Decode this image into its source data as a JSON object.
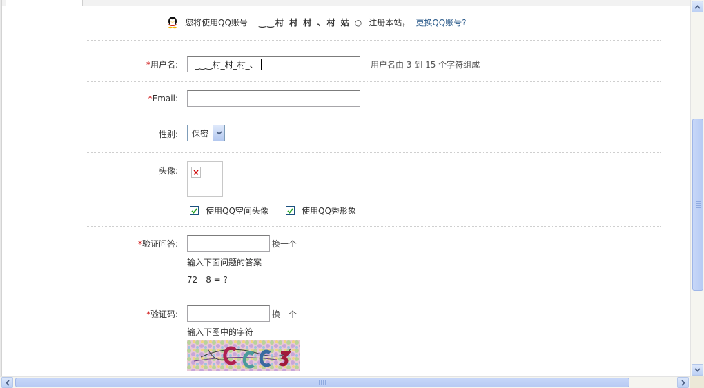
{
  "qq_notice": {
    "prefix": "您将使用QQ账号 -",
    "name": "‿‿村 村 村 、村 姑 ○",
    "suffix": "注册本站，",
    "change_link": "更换QQ账号?"
  },
  "form": {
    "username": {
      "label": "用户名:",
      "required_mark": "*",
      "value": "-_‿‿村_村_村_、",
      "hint": "用户名由 3 到 15 个字符组成"
    },
    "email": {
      "label": "Email:",
      "required_mark": "*",
      "value": ""
    },
    "gender": {
      "label": "性别:",
      "selected": "保密"
    },
    "avatar": {
      "label": "头像:",
      "options": [
        {
          "label": "使用QQ空间头像",
          "checked": true
        },
        {
          "label": "使用QQ秀形象",
          "checked": true
        }
      ]
    },
    "qa": {
      "label": "验证问答:",
      "required_mark": "*",
      "value": "",
      "change_link": "换一个",
      "instruction": "输入下面问题的答案",
      "question": "72 - 8 = ?"
    },
    "captcha": {
      "label": "验证码:",
      "required_mark": "*",
      "value": "",
      "change_link": "换一个",
      "instruction": "输入下图中的字符"
    }
  },
  "icons": {
    "qq_logo": "penguin-icon",
    "broken_image": "broken-image-icon",
    "checkbox": "check-icon",
    "dropdown": "chevron-down-icon",
    "scroll_up": "arrow-up-icon",
    "scroll_down": "arrow-down-icon",
    "scroll_left": "arrow-left-icon",
    "scroll_right": "arrow-right-icon"
  },
  "colors": {
    "required": "#cc0000",
    "link": "#2a5a8a",
    "scrollbar": "#c1d3fb"
  }
}
